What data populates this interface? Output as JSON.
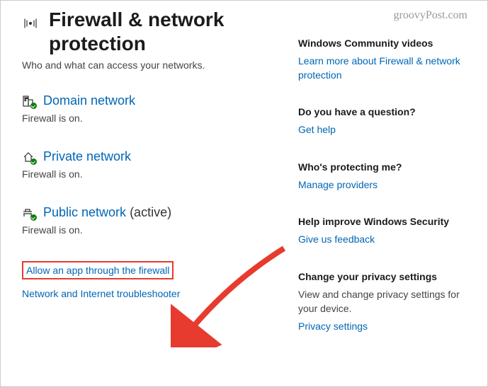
{
  "header": {
    "title": "Firewall & network protection",
    "subtitle": "Who and what can access your networks."
  },
  "networks": {
    "domain": {
      "title": "Domain network",
      "status": "Firewall is on."
    },
    "private": {
      "title": "Private network",
      "status": "Firewall is on."
    },
    "public": {
      "title": "Public network",
      "active": "  (active)",
      "status": "Firewall is on."
    }
  },
  "bottomLinks": {
    "allow": "Allow an app through the firewall",
    "troubleshoot": "Network and Internet troubleshooter"
  },
  "sidebar": {
    "videos": {
      "heading": "Windows Community videos",
      "link": "Learn more about Firewall & network protection"
    },
    "question": {
      "heading": "Do you have a question?",
      "link": "Get help"
    },
    "protecting": {
      "heading": "Who's protecting me?",
      "link": "Manage providers"
    },
    "improve": {
      "heading": "Help improve Windows Security",
      "link": "Give us feedback"
    },
    "privacy": {
      "heading": "Change your privacy settings",
      "text": "View and change privacy settings for your  device.",
      "link": "Privacy settings"
    }
  },
  "watermark": "groovyPost.com"
}
